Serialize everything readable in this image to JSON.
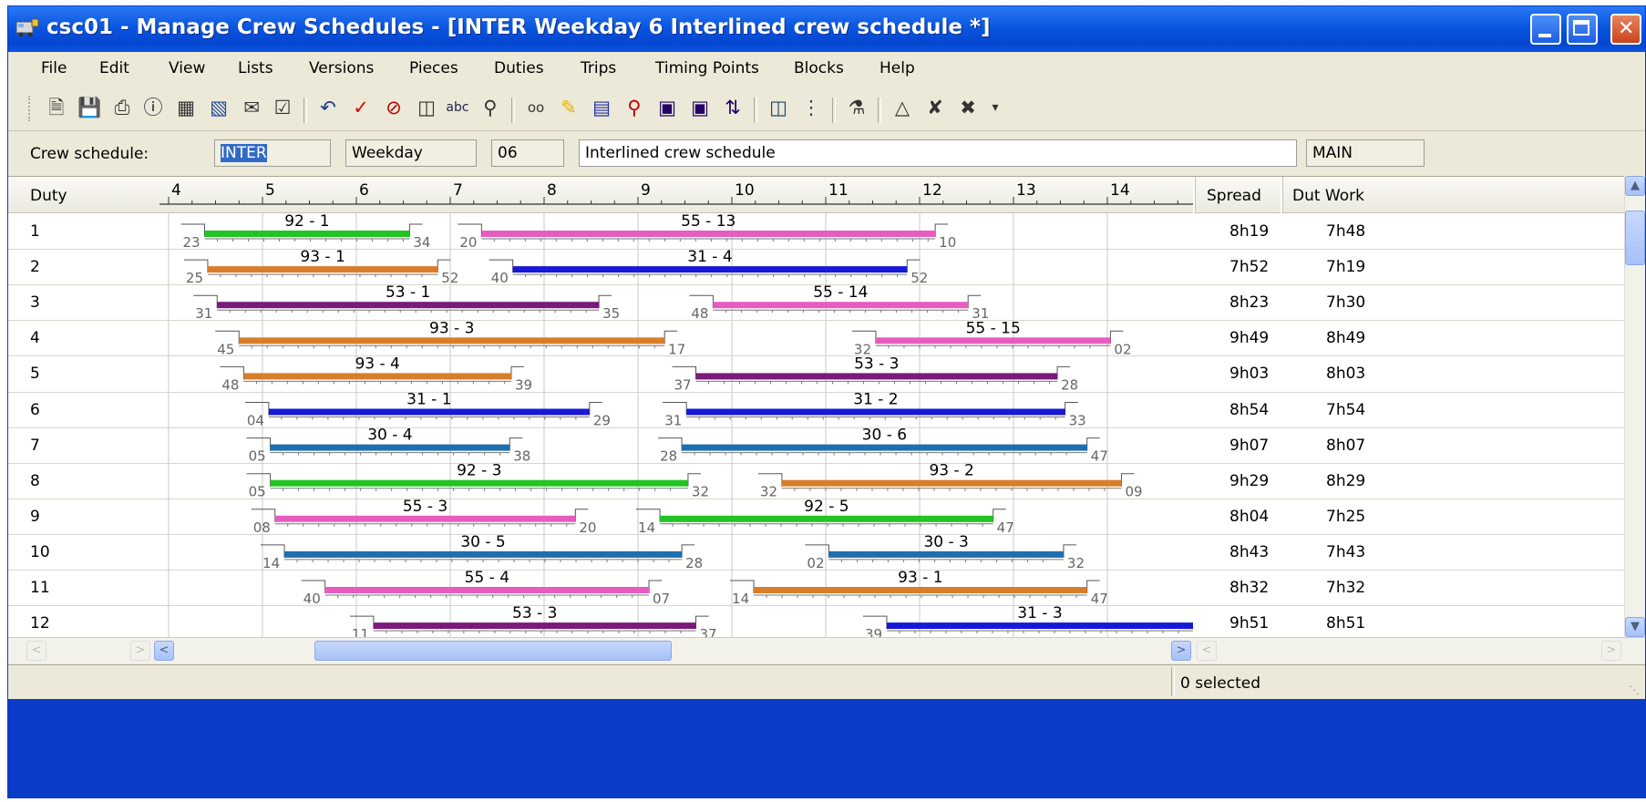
{
  "window": {
    "title": "csc01 - Manage Crew Schedules - [INTER Weekday 6 Interlined crew schedule *]"
  },
  "menu": [
    "File",
    "Edit",
    "View",
    "Lists",
    "Versions",
    "Pieces",
    "Duties",
    "Trips",
    "Timing Points",
    "Blocks",
    "Help"
  ],
  "toolbar_icons": [
    "new-icon",
    "save-icon",
    "print-icon",
    "info-icon",
    "table-icon",
    "bar-chart-icon",
    "notes-icon",
    "checkbox-icon",
    "undo-icon",
    "checkmark-icon",
    "cancel-icon",
    "properties-icon",
    "spellcheck-icon",
    "find-icon",
    "view-icon",
    "highlight-icon",
    "list-icon",
    "search-zoom-icon",
    "expand-icon",
    "collapse-icon",
    "sort-icon",
    "report-icon",
    "tree-icon",
    "split-icon",
    "add-piece-icon",
    "cut-piece-icon",
    "remove-piece-icon",
    "more-icon"
  ],
  "crew_schedule": {
    "label": "Crew schedule:",
    "id": "INTER",
    "day_type": "Weekday",
    "version": "06",
    "description": "Interlined crew schedule",
    "scenario": "MAIN"
  },
  "grid": {
    "col_duty": "Duty",
    "col_spread": "Spread",
    "col_work": "Dut Work",
    "hours": [
      "4",
      "5",
      "6",
      "7",
      "8",
      "9",
      "10",
      "11",
      "12",
      "13",
      "14"
    ]
  },
  "colors": {
    "green": "#22c422",
    "orange": "#d87e2a",
    "purple": "#7a1a7a",
    "pink": "#e85cc0",
    "blue": "#1818d8",
    "steel": "#1e6fb0"
  },
  "duties": [
    {
      "duty": "1",
      "spread": "8h19",
      "work": "7h48",
      "pieces": [
        {
          "label": "92 - 1",
          "start": "4:23",
          "end": "6:34",
          "color": "green",
          "start_min": "23",
          "end_min": "34"
        },
        {
          "label": "55 - 13",
          "start": "7:20",
          "end": "12:10",
          "color": "pink",
          "start_min": "20",
          "end_min": "10"
        }
      ]
    },
    {
      "duty": "2",
      "spread": "7h52",
      "work": "7h19",
      "pieces": [
        {
          "label": "93 - 1",
          "start": "4:25",
          "end": "6:52",
          "color": "orange",
          "start_min": "25",
          "end_min": "52"
        },
        {
          "label": "31 - 4",
          "start": "7:40",
          "end": "11:52",
          "color": "blue",
          "start_min": "40",
          "end_min": "52"
        }
      ]
    },
    {
      "duty": "3",
      "spread": "8h23",
      "work": "7h30",
      "pieces": [
        {
          "label": "53 - 1",
          "start": "4:31",
          "end": "8:35",
          "color": "purple",
          "start_min": "31",
          "end_min": "35"
        },
        {
          "label": "55 - 14",
          "start": "9:48",
          "end": "12:31",
          "color": "pink",
          "start_min": "48",
          "end_min": "31"
        }
      ]
    },
    {
      "duty": "4",
      "spread": "9h49",
      "work": "8h49",
      "pieces": [
        {
          "label": "93 - 3",
          "start": "4:45",
          "end": "9:17",
          "color": "orange",
          "start_min": "45",
          "end_min": "17"
        },
        {
          "label": "55 - 15",
          "start": "11:32",
          "end": "14:02",
          "color": "pink",
          "start_min": "32",
          "end_min": "02"
        }
      ]
    },
    {
      "duty": "5",
      "spread": "9h03",
      "work": "8h03",
      "pieces": [
        {
          "label": "93 - 4",
          "start": "4:48",
          "end": "7:39",
          "color": "orange",
          "start_min": "48",
          "end_min": "39"
        },
        {
          "label": "53 - 3",
          "start": "9:37",
          "end": "13:28",
          "color": "purple",
          "start_min": "37",
          "end_min": "28"
        }
      ]
    },
    {
      "duty": "6",
      "spread": "8h54",
      "work": "7h54",
      "pieces": [
        {
          "label": "31 - 1",
          "start": "5:04",
          "end": "8:29",
          "color": "blue",
          "start_min": "04",
          "end_min": "29"
        },
        {
          "label": "31 - 2",
          "start": "9:31",
          "end": "13:33",
          "color": "blue",
          "start_min": "31",
          "end_min": "33"
        }
      ]
    },
    {
      "duty": "7",
      "spread": "9h07",
      "work": "8h07",
      "pieces": [
        {
          "label": "30 - 4",
          "start": "5:05",
          "end": "7:38",
          "color": "steel",
          "start_min": "05",
          "end_min": "38"
        },
        {
          "label": "30 - 6",
          "start": "9:28",
          "end": "13:47",
          "color": "steel",
          "start_min": "28",
          "end_min": "47"
        }
      ]
    },
    {
      "duty": "8",
      "spread": "9h29",
      "work": "8h29",
      "pieces": [
        {
          "label": "92 - 3",
          "start": "5:05",
          "end": "9:32",
          "color": "green",
          "start_min": "05",
          "end_min": "32"
        },
        {
          "label": "93 - 2",
          "start": "10:32",
          "end": "14:09",
          "color": "orange",
          "start_min": "32",
          "end_min": "09"
        }
      ]
    },
    {
      "duty": "9",
      "spread": "8h04",
      "work": "7h25",
      "pieces": [
        {
          "label": "55 - 3",
          "start": "5:08",
          "end": "8:20",
          "color": "pink",
          "start_min": "08",
          "end_min": "20"
        },
        {
          "label": "92 - 5",
          "start": "9:14",
          "end": "12:47",
          "color": "green",
          "start_min": "14",
          "end_min": "47"
        }
      ]
    },
    {
      "duty": "10",
      "spread": "8h43",
      "work": "7h43",
      "pieces": [
        {
          "label": "30 - 5",
          "start": "5:14",
          "end": "9:28",
          "color": "steel",
          "start_min": "14",
          "end_min": "28"
        },
        {
          "label": "30 - 3",
          "start": "11:02",
          "end": "13:32",
          "color": "steel",
          "start_min": "02",
          "end_min": "32"
        }
      ]
    },
    {
      "duty": "11",
      "spread": "8h32",
      "work": "7h32",
      "pieces": [
        {
          "label": "55 - 4",
          "start": "5:40",
          "end": "9:07",
          "color": "pink",
          "start_min": "40",
          "end_min": "07"
        },
        {
          "label": "93 - 1",
          "start": "10:14",
          "end": "13:47",
          "color": "orange",
          "start_min": "14",
          "end_min": "47"
        }
      ]
    },
    {
      "duty": "12",
      "spread": "9h51",
      "work": "8h51",
      "pieces": [
        {
          "label": "53 - 3",
          "start": "6:11",
          "end": "9:37",
          "color": "purple",
          "start_min": "11",
          "end_min": "37"
        },
        {
          "label": "31 - 3",
          "start": "11:39",
          "end": "15:00",
          "color": "blue",
          "start_min": "39",
          "end_min": ""
        }
      ]
    }
  ],
  "status": {
    "selected": "0 selected"
  }
}
